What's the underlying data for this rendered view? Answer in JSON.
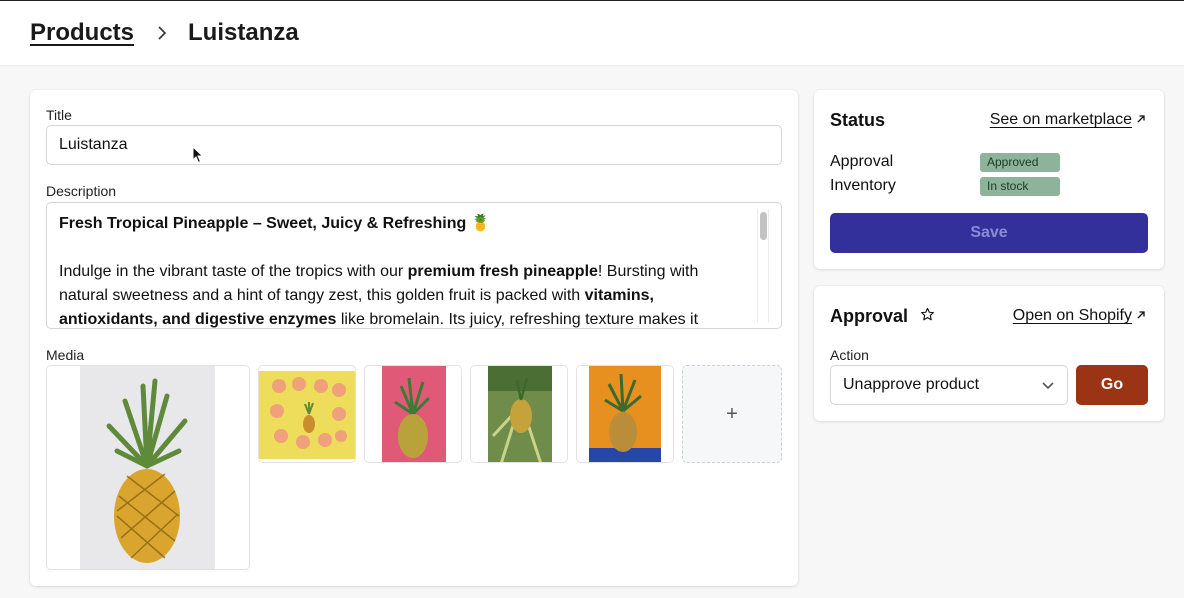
{
  "breadcrumb": {
    "parent": "Products",
    "current": "Luistanza"
  },
  "form": {
    "title_label": "Title",
    "title_value": "Luistanza",
    "description_label": "Description",
    "description": {
      "heading": "Fresh Tropical Pineapple – Sweet, Juicy & Refreshing 🍍",
      "p1_a": "Indulge in the vibrant taste of the tropics with our ",
      "p1_b": "premium fresh pineapple",
      "p1_c": "! Bursting with natural sweetness and a hint of tangy zest, this golden fruit is packed with ",
      "p1_d": "vitamins, antioxidants, and digestive enzymes",
      "p1_e": " like bromelain. Its juicy, refreshing texture makes it"
    },
    "media_label": "Media",
    "add_media_symbol": "+"
  },
  "status": {
    "title": "Status",
    "marketplace_link": "See on marketplace",
    "approval_label": "Approval",
    "approval_badge": "Approved",
    "inventory_label": "Inventory",
    "inventory_badge": "In stock",
    "save_label": "Save"
  },
  "approval": {
    "title": "Approval",
    "shopify_link": "Open on Shopify",
    "action_label": "Action",
    "action_selected": "Unapprove product",
    "go_label": "Go"
  },
  "icons": {
    "breadcrumb_separator": "chevron-right-icon",
    "external_link": "arrow-up-right-icon",
    "favorite": "star-icon",
    "dropdown": "chevron-down-icon",
    "cursor": "mouse-pointer-icon"
  },
  "colors": {
    "primary_button": "#33309b",
    "go_button": "#9a3414",
    "badge": "#8db39a"
  }
}
